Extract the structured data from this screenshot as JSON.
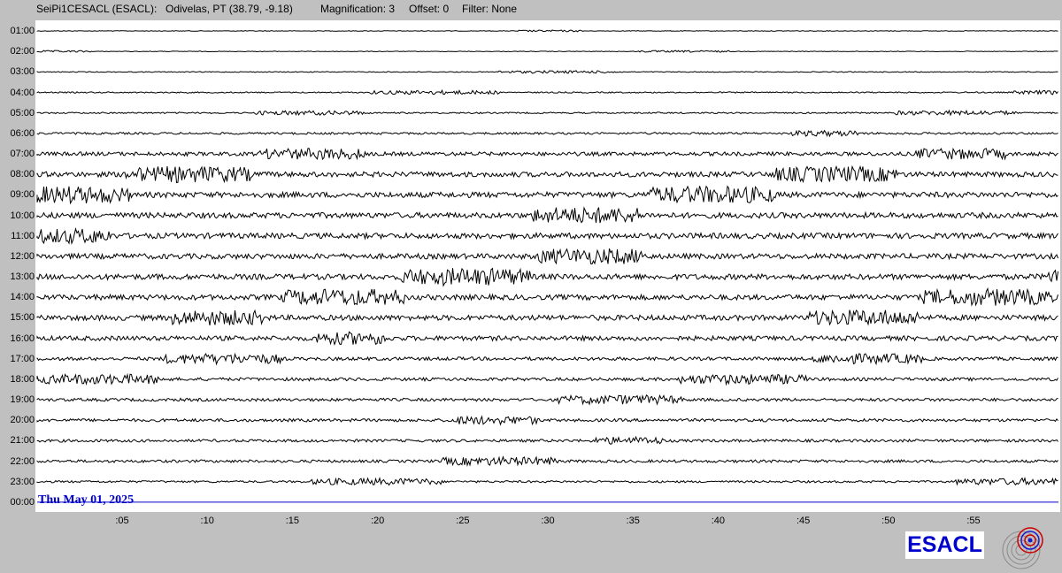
{
  "header": {
    "station": "SeiPi1CESACL (ESACL):",
    "location": "Odivelas, PT (38.79, -9.18)",
    "magnification": "Magnification: 3",
    "offset": "Offset: 0",
    "filter": "Filter: None"
  },
  "hours": [
    "01:00",
    "02:00",
    "03:00",
    "04:00",
    "05:00",
    "06:00",
    "07:00",
    "08:00",
    "09:00",
    "10:00",
    "11:00",
    "12:00",
    "13:00",
    "14:00",
    "15:00",
    "16:00",
    "17:00",
    "18:00",
    "19:00",
    "20:00",
    "21:00",
    "22:00",
    "23:00",
    "00:00"
  ],
  "minute_ticks": [
    ":05",
    ":10",
    ":15",
    ":20",
    ":25",
    ":30",
    ":35",
    ":40",
    ":45",
    ":50",
    ":55"
  ],
  "date_label": "Thu May 01, 2025",
  "logo": {
    "text": "ESACL",
    "color": "#0000cc"
  },
  "emblem_icon": "seismic-emblem-icon",
  "colors": {
    "trace": "#000000",
    "last_trace": "#0000cc",
    "background": "#c0c0c0",
    "plot_bg": "#ffffff"
  },
  "trace_activity": [
    0.3,
    0.3,
    0.4,
    0.6,
    0.7,
    1.0,
    1.8,
    2.4,
    2.6,
    2.6,
    2.6,
    2.5,
    2.6,
    2.5,
    2.5,
    2.2,
    1.6,
    1.5,
    1.4,
    1.4,
    1.3,
    1.3,
    1.0,
    0.0
  ]
}
